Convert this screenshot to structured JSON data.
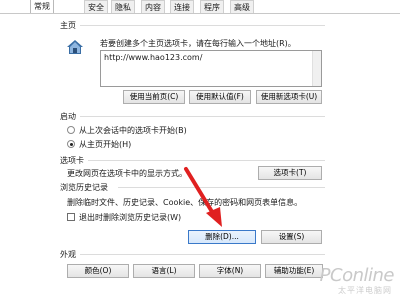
{
  "tabs": [
    {
      "label": "常规",
      "active": true
    },
    {
      "label": "安全"
    },
    {
      "label": "隐私"
    },
    {
      "label": "内容"
    },
    {
      "label": "连接"
    },
    {
      "label": "程序"
    },
    {
      "label": "高级"
    }
  ],
  "homepage": {
    "title": "主页",
    "description": "若要创建多个主页选项卡，请在每行输入一个地址(R)。",
    "url": "http://www.hao123.com/",
    "buttons": {
      "use_current": "使用当前页(C)",
      "use_default": "使用默认值(F)",
      "use_new_tab": "使用新选项卡(U)"
    }
  },
  "startup": {
    "title": "启动",
    "option_last_session": "从上次会话中的选项卡开始(B)",
    "option_home": "从主页开始(H)"
  },
  "tabs_section": {
    "title": "选项卡",
    "description": "更改网页在选项卡中的显示方式。",
    "button": "选项卡(T)"
  },
  "history": {
    "title": "浏览历史记录",
    "description": "删除临时文件、历史记录、Cookie、保存的密码和网页表单信息。",
    "checkbox_label": "退出时删除浏览历史记录(W)",
    "delete_button": "删除(D)...",
    "settings_button": "设置(S)"
  },
  "appearance": {
    "title": "外观",
    "buttons": {
      "colors": "颜色(O)",
      "languages": "语言(L)",
      "fonts": "字体(N)",
      "accessibility": "辅助功能(E)"
    }
  },
  "watermark": {
    "brand": "PConline",
    "sub": "太平洋电脑网"
  },
  "colors": {
    "arrow": "#e02020",
    "home_icon": "#3a6ea5"
  }
}
